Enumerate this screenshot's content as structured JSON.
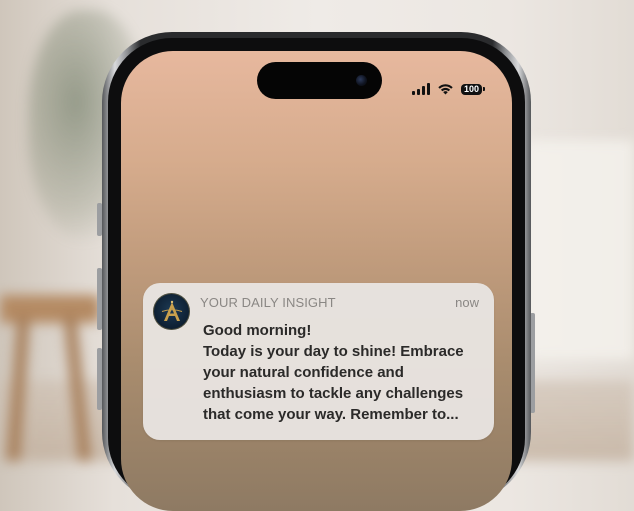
{
  "status_bar": {
    "battery_level": "100",
    "signal_icon": "cellular-signal-icon",
    "wifi_icon": "wifi-icon",
    "battery_icon": "battery-icon"
  },
  "notification": {
    "app_icon": "app-logo-icon",
    "app_name": "YOUR DAILY INSIGHT",
    "timestamp": "now",
    "title": "Good morning!",
    "body": "Today is your day to shine! Embrace\nyour natural confidence and\nenthusiasm to tackle any challenges\nthat come your way. Remember to..."
  },
  "colors": {
    "screen_gradient_top": "#e7b89e",
    "screen_gradient_bottom": "#8e7a63",
    "notification_background": "#e8e4e1",
    "app_icon_background": "#0d1e30",
    "app_icon_gold": "#c9a04d"
  }
}
